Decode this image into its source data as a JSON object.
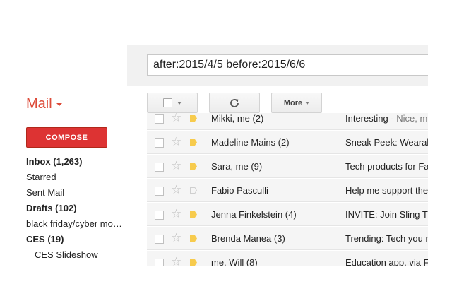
{
  "search": {
    "query": "after:2015/4/5 before:2015/6/6"
  },
  "header": {
    "app_label": "Mail"
  },
  "toolbar": {
    "more_label": "More"
  },
  "sidebar": {
    "compose_label": "COMPOSE",
    "items": [
      {
        "label": "Inbox (1,263)"
      },
      {
        "label": "Starred"
      },
      {
        "label": "Sent Mail"
      },
      {
        "label": "Drafts (102)"
      },
      {
        "label": "black friday/cyber mo…"
      },
      {
        "label": "CES (19)"
      },
      {
        "label": "CES Slideshow"
      }
    ]
  },
  "messages": [
    {
      "sender": "Mikki, me (2)",
      "subject": "Interesting",
      "snippet": " - Nice, m"
    },
    {
      "sender": "Madeline Mains (2)",
      "subject": "Sneak Peek: Wearal",
      "snippet": ""
    },
    {
      "sender": "Sara, me (9)",
      "subject": "Tech products for Fa",
      "snippet": ""
    },
    {
      "sender": "Fabio Pasculli",
      "subject": "Help me support the",
      "snippet": ""
    },
    {
      "sender": "Jenna Finkelstein (4)",
      "subject": "INVITE: Join Sling T",
      "snippet": ""
    },
    {
      "sender": "Brenda Manea (3)",
      "subject": "Trending: Tech you n",
      "snippet": ""
    },
    {
      "sender": "me, Will (8)",
      "subject": "Education app, via F",
      "snippet": ""
    }
  ],
  "colors": {
    "brand_red": "#dd4b39",
    "compose_red": "#dd3333",
    "important_marker": "#f7cb4d"
  },
  "icons": {
    "refresh": "refresh-icon",
    "star": "star-icon",
    "important": "importance-marker-icon",
    "checkbox": "checkbox-icon"
  }
}
